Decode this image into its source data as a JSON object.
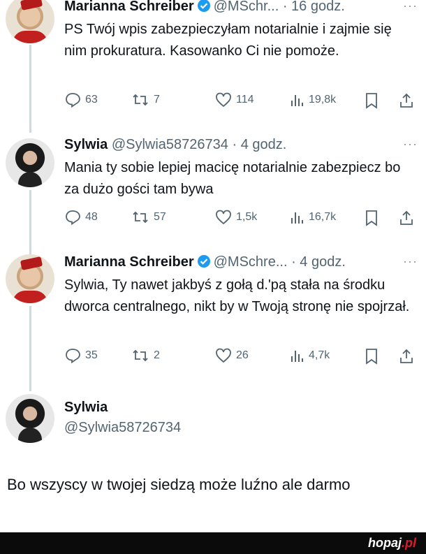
{
  "tweets": [
    {
      "name": "Marianna Schreiber",
      "handle": "@MSchr...",
      "time": "· 16 godz.",
      "more": "···",
      "text": "PS Twój wpis zabezpieczyłam notarialnie i zajmie się nim prokuratura. Kasowanko Ci nie pomoże.",
      "replies": "63",
      "retweets": "7",
      "likes": "114",
      "views": "19,8k"
    },
    {
      "name": "Sylwia",
      "handle": "@Sylwia58726734",
      "time": "· 4 godz.",
      "more": "···",
      "text": "Mania ty sobie lepiej macicę notarialnie zabezpiecz bo za dużo gości tam bywa",
      "replies": "48",
      "retweets": "57",
      "likes": "1,5k",
      "views": "16,7k"
    },
    {
      "name": "Marianna Schreiber",
      "handle": "@MSchre...",
      "time": "· 4 godz.",
      "more": "···",
      "text": "Sylwia, Ty nawet jakbyś z gołą d.'pą stała na środku dworca centralnego, nikt by w Twoją stronę nie spojrzał.",
      "replies": "35",
      "retweets": "2",
      "likes": "26",
      "views": "4,7k"
    }
  ],
  "reply": {
    "name": "Sylwia",
    "handle": "@Sylwia58726734",
    "text": "Bo wszyscy w twojej siedzą może luźno ale darmo"
  },
  "footer": {
    "brand": "hopaj",
    "tld": ".pl"
  },
  "colors": {
    "verified": "#1d9bf0",
    "footer_bg": "#0b0b0b",
    "brand_tld": "#e0182d"
  }
}
